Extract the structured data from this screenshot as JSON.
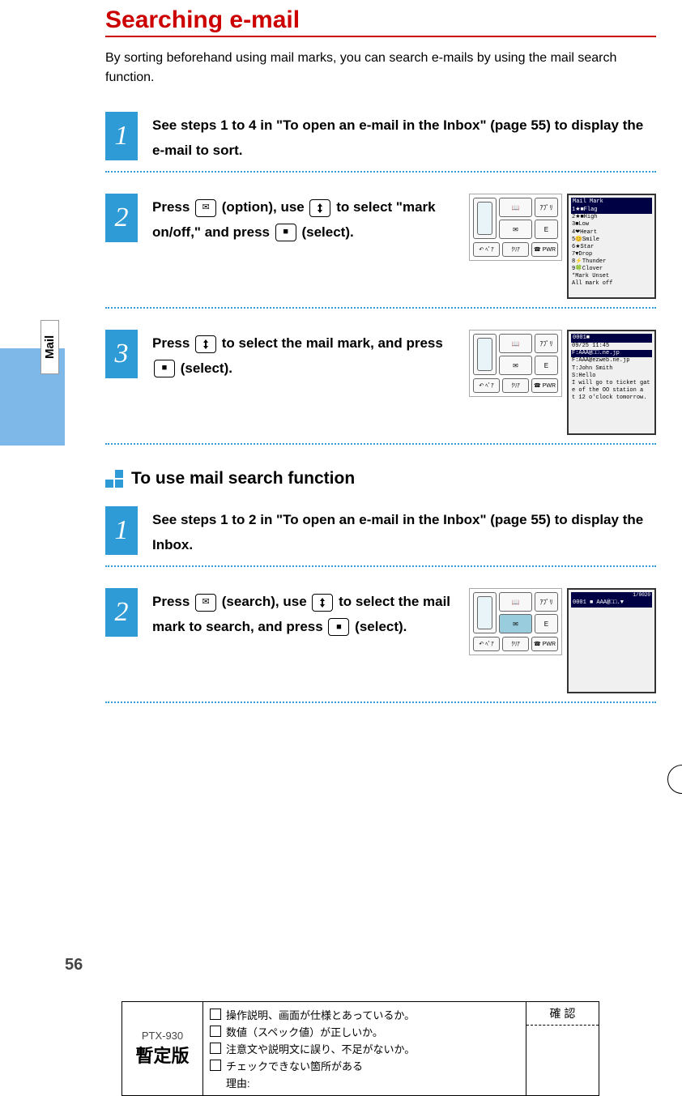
{
  "side_tab": "Mail",
  "title": "Searching e-mail",
  "intro": "By sorting beforehand using mail marks, you can search e-mails by using the mail search function.",
  "steps_a": [
    {
      "num": "1",
      "pre": "See steps 1 to 4 in \"To open an e-mail in the Inbox\" (page 55) to display the e-mail to sort.",
      "has_screens": false
    },
    {
      "num": "2",
      "pre": "Press ",
      "option": " (option), use ",
      "mid": " to select \"mark on/off,\" and press ",
      "select": " (select).",
      "has_screens": true,
      "screen_title": "Mail Mark",
      "screen_lines": [
        "1★■Flag",
        "2★■High",
        "3■Low",
        "4❤Heart",
        "5😊Smile",
        "6★Star",
        "7▼Drop",
        "8⚡Thunder",
        "9🍀Clover",
        "*Mark Unset",
        "All mark off"
      ]
    },
    {
      "num": "3",
      "pre": "Press ",
      "mid": " to select the mail mark, and press ",
      "select": " (select).",
      "has_screens": true,
      "screen_title": "0001■",
      "screen_lines": [
        "09/25 11:45",
        "F:AAA@□□.ne.jp",
        "F:AAA@ezweb.ne.jp",
        "T:John Smith",
        "S:Hello",
        "",
        "I will go to ticket gat",
        "e of the OO station a",
        "t 12 o'clock tomorrow."
      ]
    }
  ],
  "subhead": "To use mail search function",
  "steps_b": [
    {
      "num": "1",
      "pre": "See steps 1 to 2 in \"To open an e-mail in the Inbox\" (page 55) to display the Inbox.",
      "has_screens": false
    },
    {
      "num": "2",
      "pre": "Press ",
      "search": " (search), use ",
      "mid": " to select the mail mark to search, and press ",
      "select": " (select).",
      "has_screens": true,
      "screen_title": "0001 ■    AAA@□□.▼",
      "screen_lines": [
        "",
        "",
        "",
        "",
        "",
        "",
        "",
        "",
        ""
      ],
      "screen_top": "1/0020"
    }
  ],
  "pad_labels": {
    "tl": "📖",
    "tr": "ｱﾌﾟﾘ",
    "bl": "✉",
    "br": "E",
    "b1": "↶ ﾍﾟｱ",
    "b2": "ｸﾘｱ",
    "b3": "☎ PWR"
  },
  "page_num": "56",
  "footer": {
    "model": "PTX-930",
    "zantei": "暫定版",
    "checks": [
      "操作説明、画面が仕様とあっているか。",
      "数値（スペック値）が正しいか。",
      "注意文や説明文に誤り、不足がないか。",
      "チェックできない箇所がある"
    ],
    "reason_label": "理由:",
    "confirm": "確 認"
  }
}
